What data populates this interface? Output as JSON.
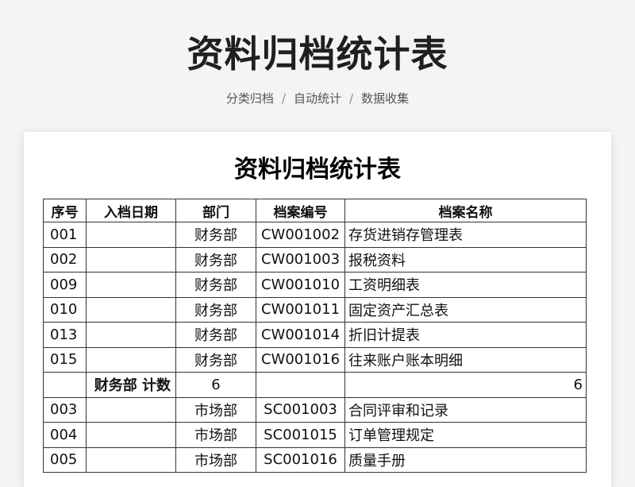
{
  "header": {
    "title": "资料归档统计表",
    "tags": [
      "分类归档",
      "自动统计",
      "数据收集"
    ],
    "separator": "/"
  },
  "sheet": {
    "title": "资料归档统计表",
    "columns": [
      "序号",
      "入档日期",
      "部门",
      "档案编号",
      "档案名称"
    ],
    "rows_group1": [
      {
        "seq": "001",
        "date": "",
        "dept": "财务部",
        "code": "CW001002",
        "name": "存货进销存管理表"
      },
      {
        "seq": "002",
        "date": "",
        "dept": "财务部",
        "code": "CW001003",
        "name": "报税资料"
      },
      {
        "seq": "009",
        "date": "",
        "dept": "财务部",
        "code": "CW001010",
        "name": "工资明细表"
      },
      {
        "seq": "010",
        "date": "",
        "dept": "财务部",
        "code": "CW001011",
        "name": "固定资产汇总表"
      },
      {
        "seq": "013",
        "date": "",
        "dept": "财务部",
        "code": "CW001014",
        "name": "折旧计提表"
      },
      {
        "seq": "015",
        "date": "",
        "dept": "财务部",
        "code": "CW001016",
        "name": "往来账户账本明细"
      }
    ],
    "subtotal": {
      "label": "财务部 计数",
      "count": "6",
      "right_value": "6"
    },
    "rows_group2": [
      {
        "seq": "003",
        "date": "",
        "dept": "市场部",
        "code": "SC001003",
        "name": "合同评审和记录"
      },
      {
        "seq": "004",
        "date": "",
        "dept": "市场部",
        "code": "SC001015",
        "name": "订单管理规定"
      },
      {
        "seq": "005",
        "date": "",
        "dept": "市场部",
        "code": "SC001016",
        "name": "质量手册"
      }
    ]
  }
}
